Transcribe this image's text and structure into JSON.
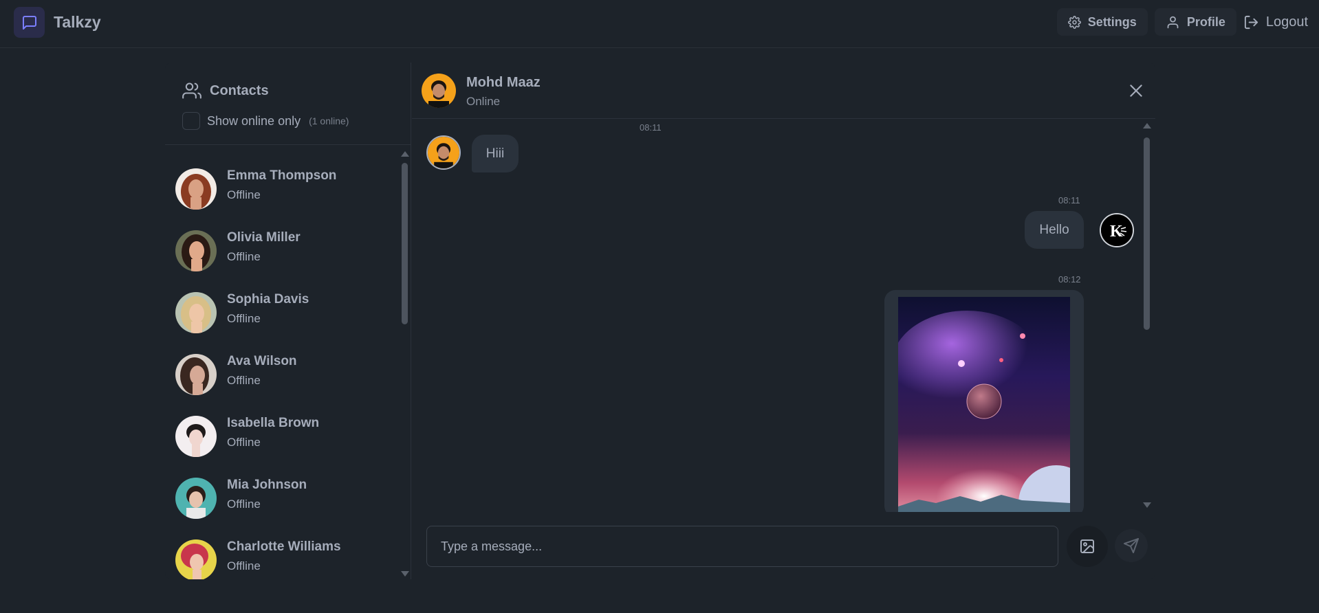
{
  "app": {
    "name": "Talkzy",
    "logo_icon": "message-square-icon",
    "accent": "#7b7fff"
  },
  "nav": {
    "settings_label": "Settings",
    "profile_label": "Profile",
    "logout_label": "Logout"
  },
  "sidebar": {
    "title": "Contacts",
    "filter_label": "Show online only",
    "online_count": "(1 online)",
    "contacts": [
      {
        "name": "Emma Thompson",
        "status": "Offline"
      },
      {
        "name": "Olivia Miller",
        "status": "Offline"
      },
      {
        "name": "Sophia Davis",
        "status": "Offline"
      },
      {
        "name": "Ava Wilson",
        "status": "Offline"
      },
      {
        "name": "Isabella Brown",
        "status": "Offline"
      },
      {
        "name": "Mia Johnson",
        "status": "Offline"
      },
      {
        "name": "Charlotte Williams",
        "status": "Offline"
      }
    ]
  },
  "chat": {
    "contact_name": "Mohd Maaz",
    "contact_status": "Online",
    "messages": [
      {
        "time": "08:11",
        "text": "Hiii",
        "from": "contact"
      },
      {
        "time": "08:11",
        "text": "Hello",
        "from": "me"
      },
      {
        "time": "08:12",
        "text": "",
        "from": "me",
        "attachment": "space-image"
      }
    ],
    "input_placeholder": "Type a message..."
  }
}
